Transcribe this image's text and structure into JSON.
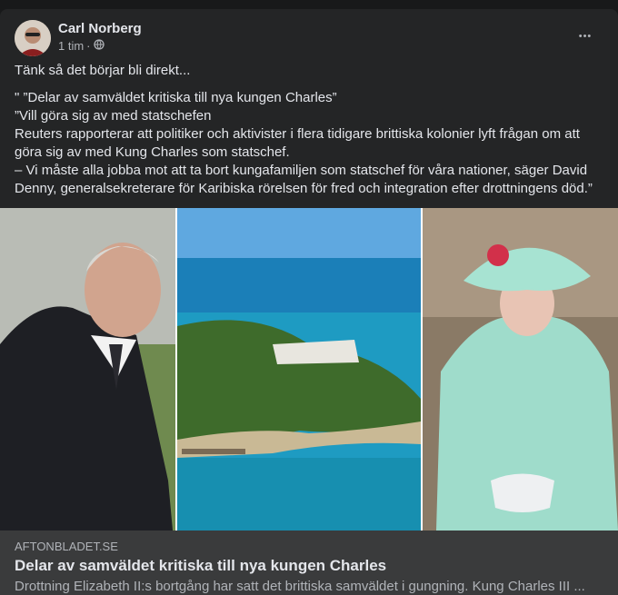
{
  "post": {
    "author": "Carl Norberg",
    "time": "1 tim",
    "separator": "·",
    "privacy_icon": "globe-icon",
    "more_icon": "more-dots-icon",
    "more_label": "•••",
    "intro": "Tänk så det börjar bli direkt...",
    "lines": [
      "\" ”Delar av samväldet kritiska till nya kungen Charles”",
      "”Vill göra sig av med statschefen",
      "Reuters rapporterar att politiker och aktivister i flera tidigare brittiska kolonier lyft frågan om att göra sig av med Kung Charles som statschef.",
      "– Vi måste alla jobba mot att ta bort kungafamiljen som statschef för våra nationer, säger David Denny, generalsekreterare för Karibiska rörelsen för fred och integration efter drottningens död.”"
    ]
  },
  "link": {
    "domain": "AFTONBLADET.SE",
    "title": "Delar av samväldet kritiska till nya kungen Charles",
    "description": "Drottning Elizabeth II:s bortgång har satt det brittiska samväldet i gungning. Kung Charles III ..."
  }
}
